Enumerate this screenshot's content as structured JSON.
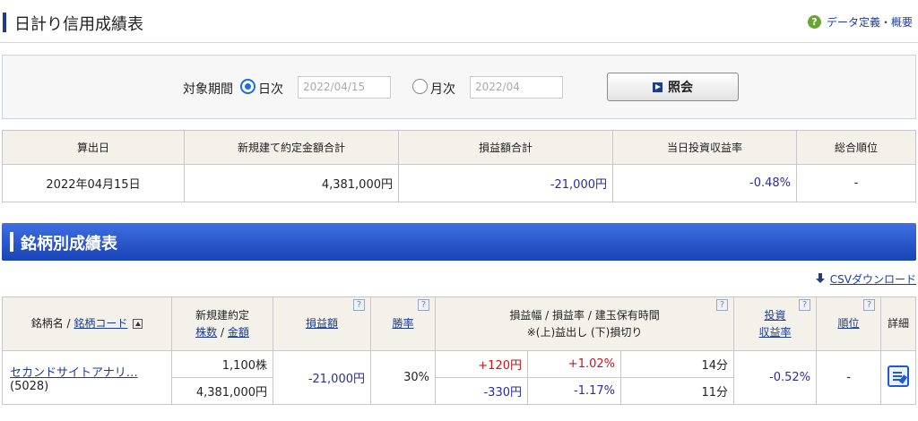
{
  "header": {
    "title": "日計り信用成績表",
    "help_link": "データ定義・概要"
  },
  "search": {
    "period_label": "対象期間",
    "daily_label": "日次",
    "daily_value": "2022/04/15",
    "monthly_label": "月次",
    "monthly_value": "2022/04",
    "submit_label": "照会",
    "selected": "daily"
  },
  "summary": {
    "headers": [
      "算出日",
      "新規建て約定金額合計",
      "損益額合計",
      "当日投資収益率",
      "総合順位"
    ],
    "values": [
      "2022年04月15日",
      "4,381,000円",
      "-21,000円",
      "-0.48%",
      "-"
    ]
  },
  "section": {
    "title": "銘柄別成績表",
    "csv_label": "CSVダウンロード"
  },
  "detail": {
    "headers": {
      "name": "銘柄名 /",
      "code": "銘柄コード",
      "contract_top": "新規建約定",
      "shares": "株数",
      "slash": "/",
      "amount": "金額",
      "pl": "損益額",
      "winrate": "勝率",
      "range_top": "損益幅 / 損益率 / 建玉保有時間",
      "range_bottom": "※(上)益出し (下)損切り",
      "roi_top": "投資",
      "roi_bottom": "収益率",
      "rank": "順位",
      "detail": "詳細",
      "help_mark": "?"
    },
    "row": {
      "name": "セカンドサイトアナリ…",
      "code": "(5028)",
      "shares": "1,100株",
      "amount": "4,381,000円",
      "pl": "-21,000円",
      "winrate": "30%",
      "profit_range": "+120円",
      "profit_rate": "+1.02%",
      "profit_time": "14分",
      "loss_range": "-330円",
      "loss_rate": "-1.17%",
      "loss_time": "11分",
      "roi": "-0.52%",
      "rank": "-"
    }
  },
  "colors": {
    "accent": "#1943b8",
    "negative": "#2b2ba0",
    "positive": "#d0101a"
  }
}
